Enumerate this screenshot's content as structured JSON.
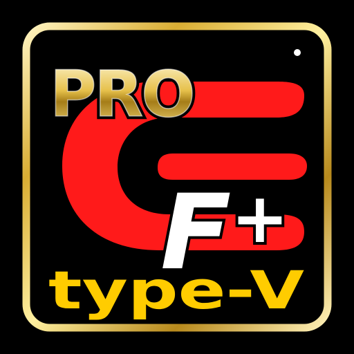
{
  "logo": {
    "top_word": "PRO",
    "emblem_letter": "F",
    "emblem_symbol": "+",
    "bottom_word": "type-V"
  },
  "colors": {
    "background": "#000000",
    "gold_light": "#fff2b0",
    "gold_mid": "#e6c04a",
    "gold_dark": "#9a7414",
    "red": "#ff1a1a",
    "white": "#ffffff",
    "yellow_text": "#ffcc00"
  },
  "icons": {
    "emblem": "red-stylized-c-mark"
  }
}
